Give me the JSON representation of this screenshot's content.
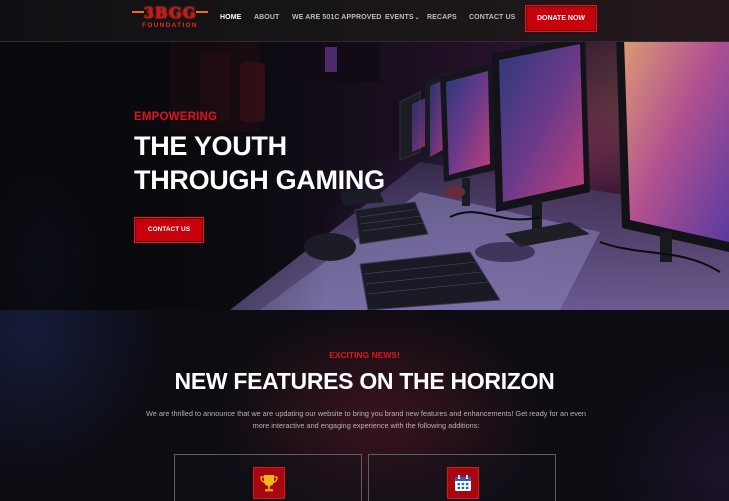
{
  "brand": {
    "logo_text": "3BGG",
    "logo_sub": "FOUNDATION"
  },
  "nav": {
    "items": [
      {
        "label": "HOME",
        "active": true
      },
      {
        "label": "ABOUT"
      },
      {
        "label": "WE ARE 501C APPROVED"
      },
      {
        "label": "EVENTS",
        "has_dropdown": true
      },
      {
        "label": "RECAPS"
      },
      {
        "label": "CONTACT US"
      }
    ],
    "donate_label": "DONATE NOW"
  },
  "hero": {
    "kicker": "EMPOWERING",
    "title_line1": "THE YOUTH",
    "title_line2": "THROUGH GAMING",
    "cta_label": "CONTACT US"
  },
  "news": {
    "kicker": "EXCITING NEWS!",
    "title": "NEW FEATURES ON THE HORIZON",
    "body": "We are thrilled to announce that we are updating our website to bring you brand new features and enhancements! Get ready for an even more interactive and engaging experience with the following additions:",
    "cards": [
      {
        "icon": "trophy-icon"
      },
      {
        "icon": "calendar-icon"
      }
    ]
  },
  "colors": {
    "accent_red": "#c8000c",
    "kicker_red": "#e1121d"
  }
}
